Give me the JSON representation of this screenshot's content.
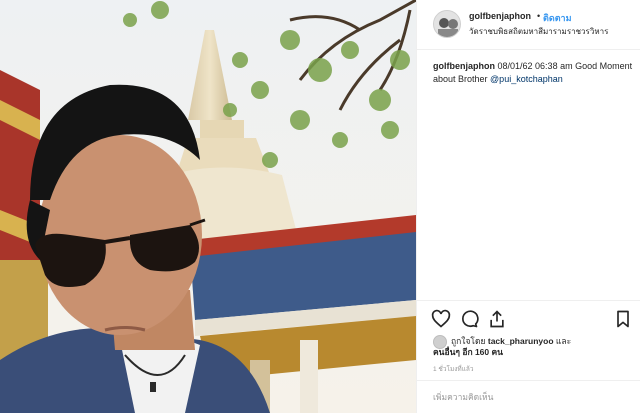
{
  "post": {
    "username": "golfbenjaphon",
    "separator": "•",
    "follow_label": "ติดตาม",
    "location": "วัดราชบพิธสถิตมหาสีมารามราชวรวิหาร"
  },
  "caption": {
    "username": "golfbenjaphon",
    "text": "08/01/62 06:38 am Good Moment about Brother ",
    "mention": "@pui_kotchaphan"
  },
  "actions": {
    "like_icon": "heart-icon",
    "comment_icon": "comment-icon",
    "share_icon": "share-icon",
    "save_icon": "bookmark-icon"
  },
  "likes": {
    "prefix": "ถูกใจโดย ",
    "liker": "tack_pharunyoo",
    "and": " และ",
    "others_prefix": "คนอื่นๆ ",
    "others_count": "อีก 160 คน"
  },
  "timestamp": "1 ชั่วโมงที่แล้ว",
  "comment_placeholder": "เพิ่มความคิดเห็น"
}
